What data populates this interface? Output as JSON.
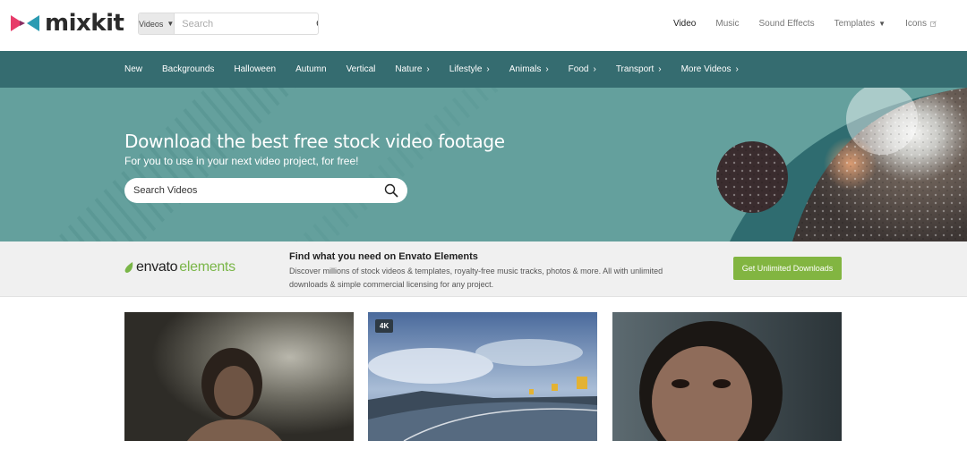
{
  "brand": {
    "name": "mixkit",
    "mark_colors": [
      "#e73c6a",
      "#2b9bb2"
    ]
  },
  "header": {
    "search": {
      "type_label": "Videos",
      "placeholder": "Search"
    },
    "nav": [
      {
        "label": "Video",
        "active": true
      },
      {
        "label": "Music"
      },
      {
        "label": "Sound Effects"
      },
      {
        "label": "Templates",
        "dropdown": true
      },
      {
        "label": "Icons",
        "external": true
      }
    ]
  },
  "categories": [
    {
      "label": "New"
    },
    {
      "label": "Backgrounds"
    },
    {
      "label": "Halloween"
    },
    {
      "label": "Autumn"
    },
    {
      "label": "Vertical"
    },
    {
      "label": "Nature",
      "chevron": true
    },
    {
      "label": "Lifestyle",
      "chevron": true
    },
    {
      "label": "Animals",
      "chevron": true
    },
    {
      "label": "Food",
      "chevron": true
    },
    {
      "label": "Transport",
      "chevron": true
    },
    {
      "label": "More Videos",
      "chevron": true
    }
  ],
  "hero": {
    "title": "Download the best free stock video footage",
    "subtitle": "For you to use in your next video project, for free!",
    "search_placeholder": "Search Videos"
  },
  "envato": {
    "logo_part1": "envato",
    "logo_part2": "elements",
    "title": "Find what you need on Envato Elements",
    "description": "Discover millions of stock videos & templates, royalty-free music tracks, photos & more. All with unlimited downloads & simple commercial licensing for any project.",
    "button": "Get Unlimited Downloads",
    "accent": "#82b541"
  },
  "videos": [
    {
      "subject": "woman in dark room",
      "badge": ""
    },
    {
      "subject": "mountain road with clouds",
      "badge": "4K"
    },
    {
      "subject": "close-up of woman face",
      "badge": ""
    }
  ],
  "colors": {
    "category_bar": "#356c70",
    "hero_bg": "#64a09d"
  }
}
